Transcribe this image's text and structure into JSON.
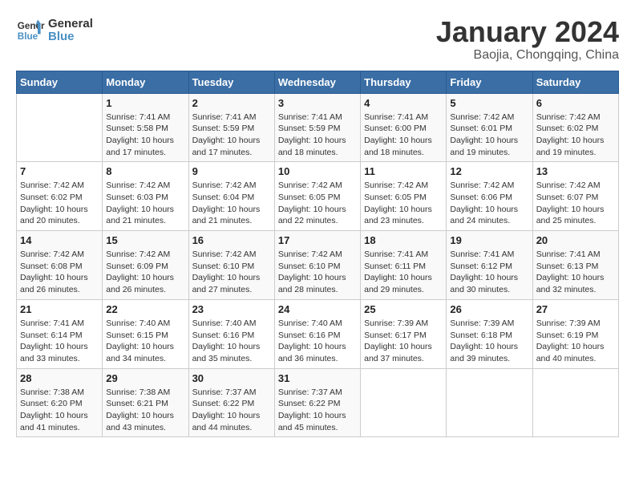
{
  "header": {
    "logo_line1": "General",
    "logo_line2": "Blue",
    "title": "January 2024",
    "subtitle": "Baojia, Chongqing, China"
  },
  "columns": [
    "Sunday",
    "Monday",
    "Tuesday",
    "Wednesday",
    "Thursday",
    "Friday",
    "Saturday"
  ],
  "weeks": [
    [
      {
        "day": "",
        "info": ""
      },
      {
        "day": "1",
        "info": "Sunrise: 7:41 AM\nSunset: 5:58 PM\nDaylight: 10 hours\nand 17 minutes."
      },
      {
        "day": "2",
        "info": "Sunrise: 7:41 AM\nSunset: 5:59 PM\nDaylight: 10 hours\nand 17 minutes."
      },
      {
        "day": "3",
        "info": "Sunrise: 7:41 AM\nSunset: 5:59 PM\nDaylight: 10 hours\nand 18 minutes."
      },
      {
        "day": "4",
        "info": "Sunrise: 7:41 AM\nSunset: 6:00 PM\nDaylight: 10 hours\nand 18 minutes."
      },
      {
        "day": "5",
        "info": "Sunrise: 7:42 AM\nSunset: 6:01 PM\nDaylight: 10 hours\nand 19 minutes."
      },
      {
        "day": "6",
        "info": "Sunrise: 7:42 AM\nSunset: 6:02 PM\nDaylight: 10 hours\nand 19 minutes."
      }
    ],
    [
      {
        "day": "7",
        "info": "Sunrise: 7:42 AM\nSunset: 6:02 PM\nDaylight: 10 hours\nand 20 minutes."
      },
      {
        "day": "8",
        "info": "Sunrise: 7:42 AM\nSunset: 6:03 PM\nDaylight: 10 hours\nand 21 minutes."
      },
      {
        "day": "9",
        "info": "Sunrise: 7:42 AM\nSunset: 6:04 PM\nDaylight: 10 hours\nand 21 minutes."
      },
      {
        "day": "10",
        "info": "Sunrise: 7:42 AM\nSunset: 6:05 PM\nDaylight: 10 hours\nand 22 minutes."
      },
      {
        "day": "11",
        "info": "Sunrise: 7:42 AM\nSunset: 6:05 PM\nDaylight: 10 hours\nand 23 minutes."
      },
      {
        "day": "12",
        "info": "Sunrise: 7:42 AM\nSunset: 6:06 PM\nDaylight: 10 hours\nand 24 minutes."
      },
      {
        "day": "13",
        "info": "Sunrise: 7:42 AM\nSunset: 6:07 PM\nDaylight: 10 hours\nand 25 minutes."
      }
    ],
    [
      {
        "day": "14",
        "info": "Sunrise: 7:42 AM\nSunset: 6:08 PM\nDaylight: 10 hours\nand 26 minutes."
      },
      {
        "day": "15",
        "info": "Sunrise: 7:42 AM\nSunset: 6:09 PM\nDaylight: 10 hours\nand 26 minutes."
      },
      {
        "day": "16",
        "info": "Sunrise: 7:42 AM\nSunset: 6:10 PM\nDaylight: 10 hours\nand 27 minutes."
      },
      {
        "day": "17",
        "info": "Sunrise: 7:42 AM\nSunset: 6:10 PM\nDaylight: 10 hours\nand 28 minutes."
      },
      {
        "day": "18",
        "info": "Sunrise: 7:41 AM\nSunset: 6:11 PM\nDaylight: 10 hours\nand 29 minutes."
      },
      {
        "day": "19",
        "info": "Sunrise: 7:41 AM\nSunset: 6:12 PM\nDaylight: 10 hours\nand 30 minutes."
      },
      {
        "day": "20",
        "info": "Sunrise: 7:41 AM\nSunset: 6:13 PM\nDaylight: 10 hours\nand 32 minutes."
      }
    ],
    [
      {
        "day": "21",
        "info": "Sunrise: 7:41 AM\nSunset: 6:14 PM\nDaylight: 10 hours\nand 33 minutes."
      },
      {
        "day": "22",
        "info": "Sunrise: 7:40 AM\nSunset: 6:15 PM\nDaylight: 10 hours\nand 34 minutes."
      },
      {
        "day": "23",
        "info": "Sunrise: 7:40 AM\nSunset: 6:16 PM\nDaylight: 10 hours\nand 35 minutes."
      },
      {
        "day": "24",
        "info": "Sunrise: 7:40 AM\nSunset: 6:16 PM\nDaylight: 10 hours\nand 36 minutes."
      },
      {
        "day": "25",
        "info": "Sunrise: 7:39 AM\nSunset: 6:17 PM\nDaylight: 10 hours\nand 37 minutes."
      },
      {
        "day": "26",
        "info": "Sunrise: 7:39 AM\nSunset: 6:18 PM\nDaylight: 10 hours\nand 39 minutes."
      },
      {
        "day": "27",
        "info": "Sunrise: 7:39 AM\nSunset: 6:19 PM\nDaylight: 10 hours\nand 40 minutes."
      }
    ],
    [
      {
        "day": "28",
        "info": "Sunrise: 7:38 AM\nSunset: 6:20 PM\nDaylight: 10 hours\nand 41 minutes."
      },
      {
        "day": "29",
        "info": "Sunrise: 7:38 AM\nSunset: 6:21 PM\nDaylight: 10 hours\nand 43 minutes."
      },
      {
        "day": "30",
        "info": "Sunrise: 7:37 AM\nSunset: 6:22 PM\nDaylight: 10 hours\nand 44 minutes."
      },
      {
        "day": "31",
        "info": "Sunrise: 7:37 AM\nSunset: 6:22 PM\nDaylight: 10 hours\nand 45 minutes."
      },
      {
        "day": "",
        "info": ""
      },
      {
        "day": "",
        "info": ""
      },
      {
        "day": "",
        "info": ""
      }
    ]
  ]
}
